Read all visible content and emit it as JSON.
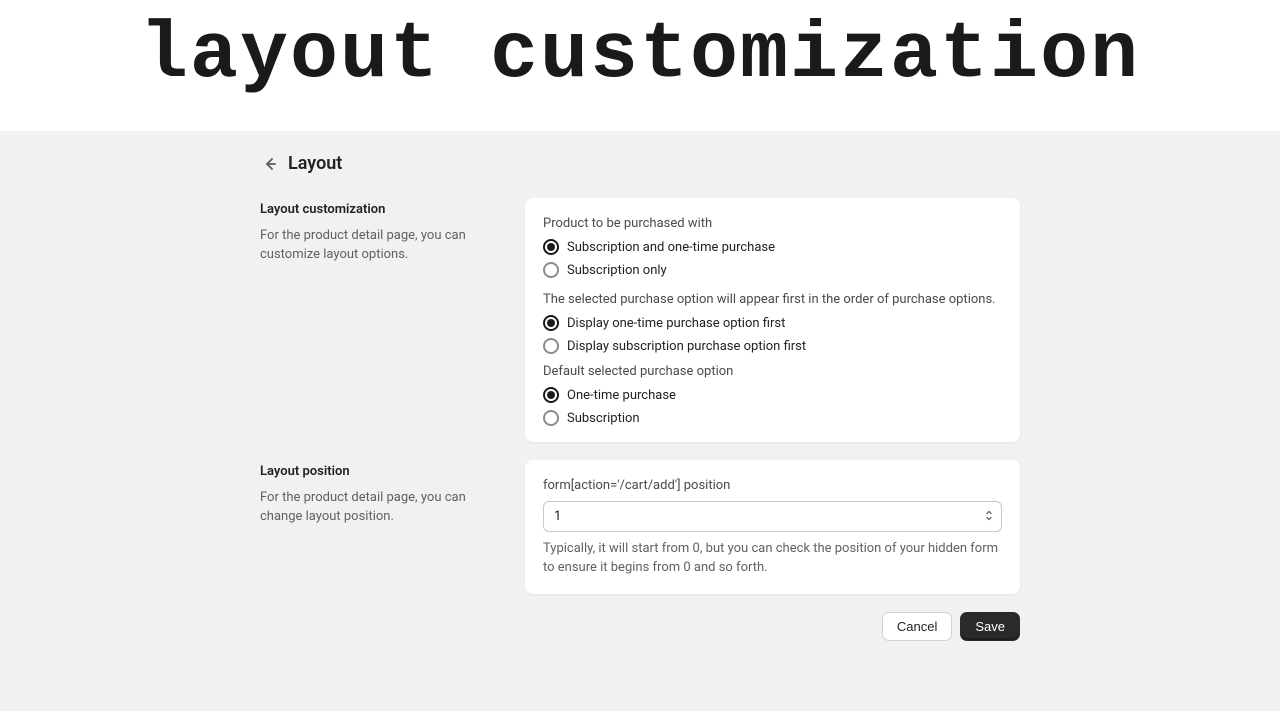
{
  "hero": {
    "title": "layout customization"
  },
  "page": {
    "title": "Layout"
  },
  "sections": {
    "customization": {
      "title": "Layout customization",
      "description": "For the product detail page, you can customize layout options.",
      "groups": {
        "purchaseWith": {
          "label": "Product to be purchased with",
          "options": {
            "both": "Subscription and one-time purchase",
            "subOnly": "Subscription only"
          }
        },
        "orderFirst": {
          "label": "The selected purchase option will appear first in the order of purchase options.",
          "options": {
            "onetimeFirst": "Display one-time purchase option first",
            "subFirst": "Display subscription purchase option first"
          }
        },
        "defaultSelected": {
          "label": "Default selected purchase option",
          "options": {
            "onetime": "One-time purchase",
            "subscription": "Subscription"
          }
        }
      }
    },
    "position": {
      "title": "Layout position",
      "description": "For the product detail page, you can change layout position.",
      "field": {
        "label": "form[action='/cart/add'] position",
        "value": "1",
        "help": "Typically, it will start from 0, but you can check the position of your hidden form to ensure it begins from 0 and so forth."
      }
    }
  },
  "actions": {
    "cancel": "Cancel",
    "save": "Save"
  }
}
